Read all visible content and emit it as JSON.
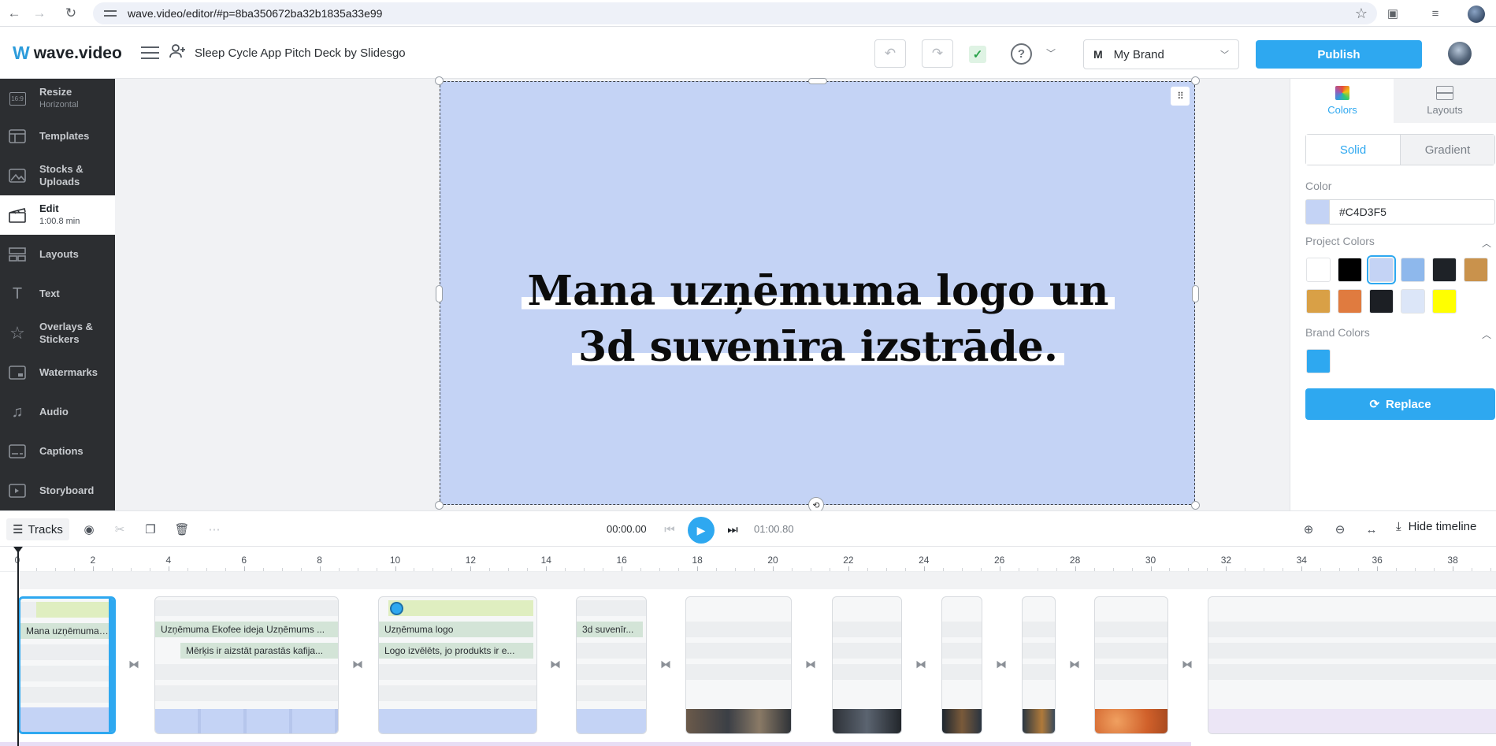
{
  "browser": {
    "url": "wave.video/editor/#p=8ba350672ba32b1835a33e99",
    "back_icon": "←",
    "forward_icon": "→",
    "reload_icon": "↻",
    "star_icon": "☆"
  },
  "header": {
    "logo_mark": "W",
    "logo_text": "wave.video",
    "project_title": "Sleep Cycle App Pitch Deck by Slidesgo",
    "undo_icon": "↶",
    "redo_icon": "↷",
    "saved_icon": "✓",
    "help_icon": "?",
    "brand_letter": "M",
    "brand_name": "My Brand",
    "publish_label": "Publish"
  },
  "sidebar": {
    "items": [
      {
        "label": "Resize",
        "sub": "Horizontal",
        "icon_text": "16:9"
      },
      {
        "label": "Templates",
        "sub": ""
      },
      {
        "label": "Stocks & Uploads",
        "sub": ""
      },
      {
        "label": "Edit",
        "sub": "1:00.8 min"
      },
      {
        "label": "Layouts",
        "sub": ""
      },
      {
        "label": "Text",
        "sub": "",
        "icon_text": "T"
      },
      {
        "label": "Overlays & Stickers",
        "sub": ""
      },
      {
        "label": "Watermarks",
        "sub": ""
      },
      {
        "label": "Audio",
        "sub": ""
      },
      {
        "label": "Captions",
        "sub": ""
      },
      {
        "label": "Storyboard",
        "sub": ""
      }
    ]
  },
  "canvas": {
    "headline_line1": "Mana uzņēmuma logo un",
    "headline_line2": "3d suvenīra izstrāde.",
    "background": "#C4D3F5"
  },
  "right_panel": {
    "tab_colors": "Colors",
    "tab_layouts": "Layouts",
    "solid_label": "Solid",
    "gradient_label": "Gradient",
    "color_label": "Color",
    "color_value": "#C4D3F5",
    "project_colors_label": "Project Colors",
    "project_colors": [
      "#FFFFFF",
      "#000000",
      "#C4D3F5",
      "#8EB8EC",
      "#1E2227",
      "#C9924C",
      "#D9A046",
      "#E07B3F",
      "#1C1F24",
      "#DCE6F8",
      "#FFFF00"
    ],
    "brand_colors_label": "Brand Colors",
    "brand_colors": [
      "#2EA8F0"
    ],
    "replace_label": "Replace"
  },
  "toolbar": {
    "tracks_label": "Tracks",
    "current_time": "00:00.00",
    "total_time": "01:00.80",
    "hide_timeline_label": "Hide timeline"
  },
  "timeline": {
    "ticks": [
      "0",
      "2",
      "4",
      "6",
      "8",
      "10",
      "12",
      "14",
      "16",
      "18",
      "20",
      "22",
      "24",
      "26",
      "28",
      "30",
      "32",
      "34",
      "36",
      "38"
    ],
    "clip1_text": "Mana uzņēmuma ...",
    "clip2_text_a": "Uzņēmuma Ekofee ideja  Uzņēmums ...",
    "clip2_text_b": "Mērķis ir aizstāt parastās kafija...",
    "clip3_text_a": "Uzņēmuma logo",
    "clip3_text_b": "Logo izvēlēts,  jo produkts  ir e...",
    "clip4_text": "3d suvenīr..."
  }
}
